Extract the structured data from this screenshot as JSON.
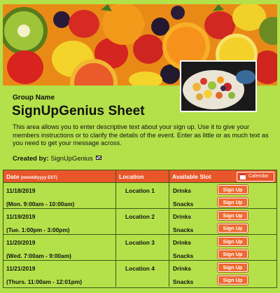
{
  "header": {
    "group_name": "Group Name",
    "title": "SignUpGenius Sheet",
    "description": "This area allows you to enter descriptive text about your sign up. Use it to give your members instructions or to clarify the details of the event. Enter as little or as much text as you need to get your message across.",
    "created_by_label": "Created by:",
    "created_by_name": "SignUpGenius"
  },
  "table": {
    "col_date": "Date",
    "col_date_format": "(mm/dd/yyyy EST)",
    "col_location": "Location",
    "col_slot": "Available Slot",
    "calendar_button": "Calendar",
    "signup_label": "Sign Up",
    "rows": [
      {
        "date": "11/18/2019",
        "time": "(Mon. 9:00am - 10:00am)",
        "location": "Location 1",
        "slots": [
          "Drinks",
          "Snacks"
        ]
      },
      {
        "date": "11/19/2019",
        "time": "(Tue. 1:00pm - 3:00pm)",
        "location": "Location 2",
        "slots": [
          "Drinks",
          "Snacks"
        ]
      },
      {
        "date": "11/20/2019",
        "time": "(Wed. 7:00am - 9:00am)",
        "location": "Location 3",
        "slots": [
          "Drinks",
          "Snacks"
        ]
      },
      {
        "date": "11/21/2019",
        "time": "(Thurs. 11:00am - 12:01pm)",
        "location": "Location 4",
        "slots": [
          "Drinks",
          "Snacks"
        ]
      }
    ]
  },
  "colors": {
    "background": "#b4e14a",
    "table_header": "#e8562a",
    "button": "#ee6a30"
  }
}
